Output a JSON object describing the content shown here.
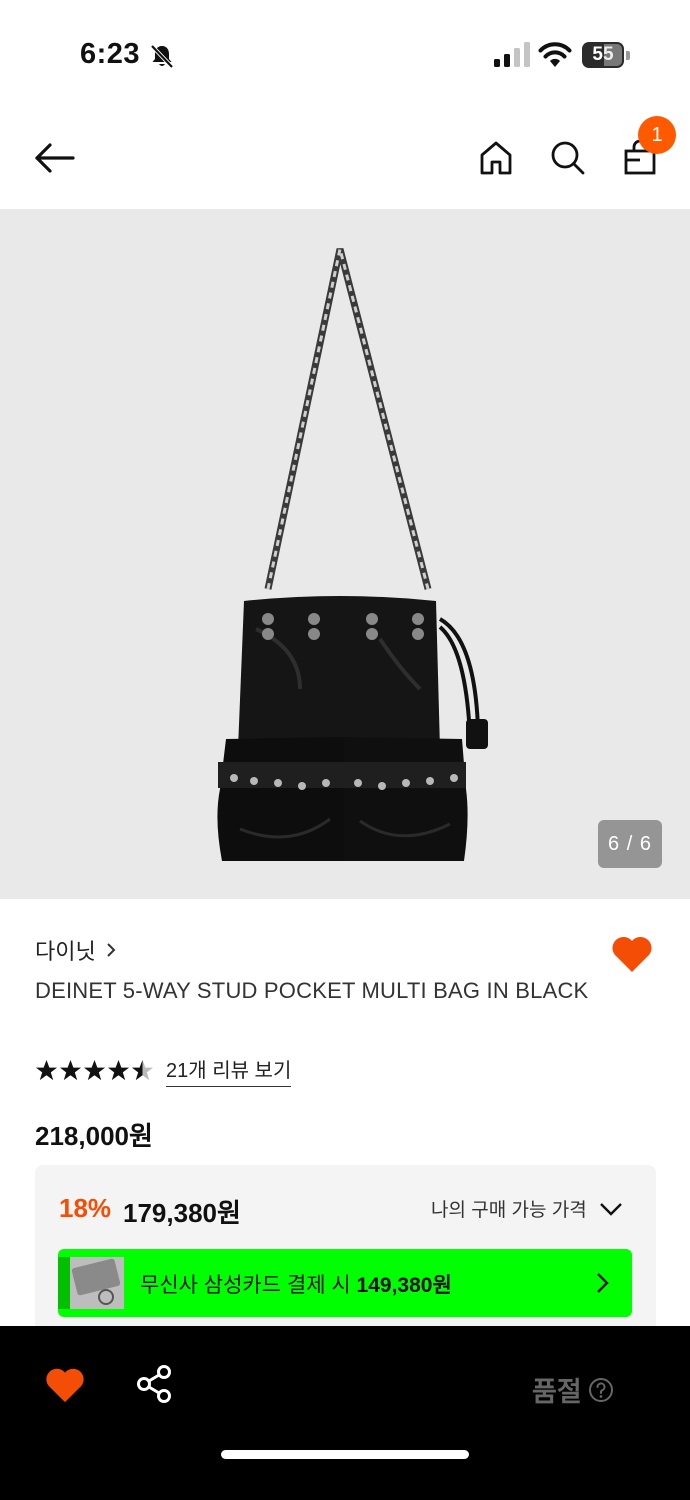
{
  "status_bar": {
    "time": "6:23",
    "battery": "55"
  },
  "nav": {
    "cart_count": "1"
  },
  "gallery": {
    "counter": "6 / 6"
  },
  "product": {
    "brand": "다이닛",
    "name": "DEINET 5-WAY STUD POCKET MULTI BAG IN BLACK",
    "rating": 4.5,
    "review_link": "21개 리뷰 보기",
    "original_price": "218,000원"
  },
  "price_box": {
    "discount": "18%",
    "sale_price": "179,380원",
    "my_price_label": "나의 구매 가능 가격",
    "card_offer_prefix": "무신사 삼성카드 결제 시 ",
    "card_offer_price": "149,380원"
  },
  "bottom_bar": {
    "status_label": "품절"
  },
  "colors": {
    "accent": "#f44d06",
    "badge": "#ff5a00",
    "card_banner": "#00ff00",
    "bottom_bar": "#000000"
  },
  "icons": [
    "bell-off-icon",
    "signal-icon",
    "wifi-icon",
    "battery-icon",
    "back-arrow-icon",
    "home-icon",
    "search-icon",
    "cart-icon",
    "heart-icon",
    "star-icon",
    "chevron-down-icon",
    "chevron-right-icon",
    "share-icon",
    "help-icon"
  ]
}
